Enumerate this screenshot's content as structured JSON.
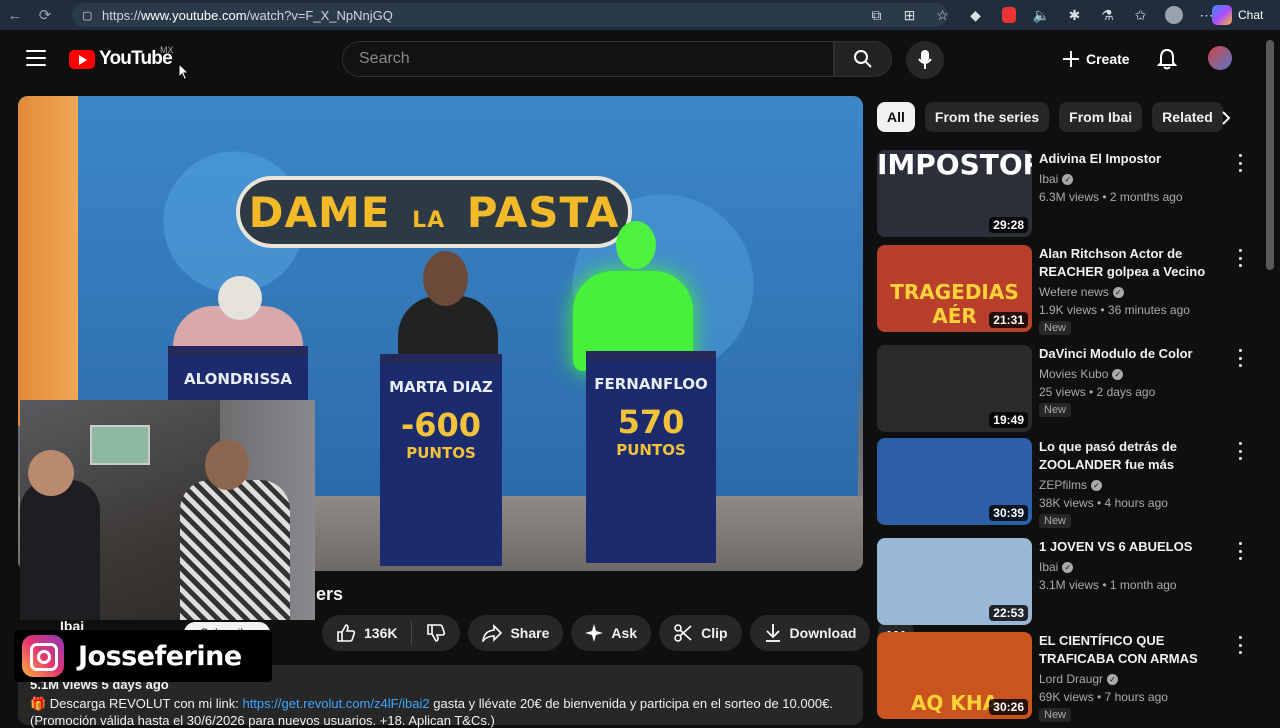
{
  "browser": {
    "url_prefix": "https://",
    "url_domain": "www.youtube.com",
    "url_path": "/watch?v=F_X_NpNnjGQ",
    "chat_label": "Chat"
  },
  "masthead": {
    "logo_text": "YouTube",
    "country_code": "MX",
    "search_placeholder": "Search",
    "create_label": "Create"
  },
  "player": {
    "show_title": "DAME",
    "show_title_mid": "LA",
    "show_title_end": "PASTA",
    "podiums": [
      {
        "name": "ALONDRISSA",
        "score": "",
        "points": ""
      },
      {
        "name": "MARTA DIAZ",
        "score": "-600",
        "points": "PUNTOS"
      },
      {
        "name": "FERNANFLOO",
        "score": "570",
        "points": "PUNTOS"
      }
    ]
  },
  "video": {
    "title_visible": "ers",
    "channel": "Ibai",
    "subscribe_label": "Subscribe",
    "likes": "136K",
    "share_label": "Share",
    "ask_label": "Ask",
    "clip_label": "Clip",
    "download_label": "Download",
    "meta": "5.1M views  5 days ago",
    "desc_prefix": "🎁 Descarga REVOLUT con mi link: ",
    "desc_link": "https://get.revolut.com/z4lF/ibai2",
    "desc_suffix": " gasta y llévate 20€ de bienvenida y participa en el sorteo de 10.000€.",
    "desc_line2": "(Promoción válida hasta el 30/6/2026 para nuevos usuarios. +18. Aplican T&Cs.)"
  },
  "overlay": {
    "instagram_handle": "Josseferine"
  },
  "chips": [
    "All",
    "From the series",
    "From Ibai",
    "Related"
  ],
  "recommendations": [
    {
      "title": "Adivina El Impostor",
      "channel": "Ibai",
      "meta": "6.3M views • 2 months ago",
      "duration": "29:28",
      "badge": "",
      "thumb_text": "IMPOSTOR",
      "bg": "#2b2f3a"
    },
    {
      "title": "Alan Ritchson Actor de REACHER golpea a Vecino en ...",
      "channel": "Wefere news",
      "meta": "1.9K views • 36 minutes ago",
      "duration": "21:31",
      "badge": "New",
      "thumb_text": "TRAGEDIAS AÉR",
      "bg": "#b8402a"
    },
    {
      "title": "DaVinci Modulo de Color",
      "channel": "Movies Kubo",
      "meta": "25 views • 2 days ago",
      "duration": "19:49",
      "badge": "New",
      "thumb_text": "",
      "bg": "#2a2a2c"
    },
    {
      "title": "Lo que pasó detrás de ZOOLANDER fue más polémic...",
      "channel": "ZEPfilms",
      "meta": "38K views • 4 hours ago",
      "duration": "30:39",
      "badge": "New",
      "thumb_text": "",
      "bg": "#2d5fa8"
    },
    {
      "title": "1 JOVEN VS 6 ABUELOS",
      "channel": "Ibai",
      "meta": "3.1M views • 1 month ago",
      "duration": "22:53",
      "badge": "",
      "thumb_text": "",
      "bg": "#9ab7d6"
    },
    {
      "title": "EL CIENTÍFICO QUE TRAFICABA CON ARMAS NUCLEARES | AQ...",
      "channel": "Lord Draugr",
      "meta": "69K views • 7 hours ago",
      "duration": "30:26",
      "badge": "New",
      "thumb_text": "AQ KHA",
      "bg": "#c9541e"
    }
  ]
}
